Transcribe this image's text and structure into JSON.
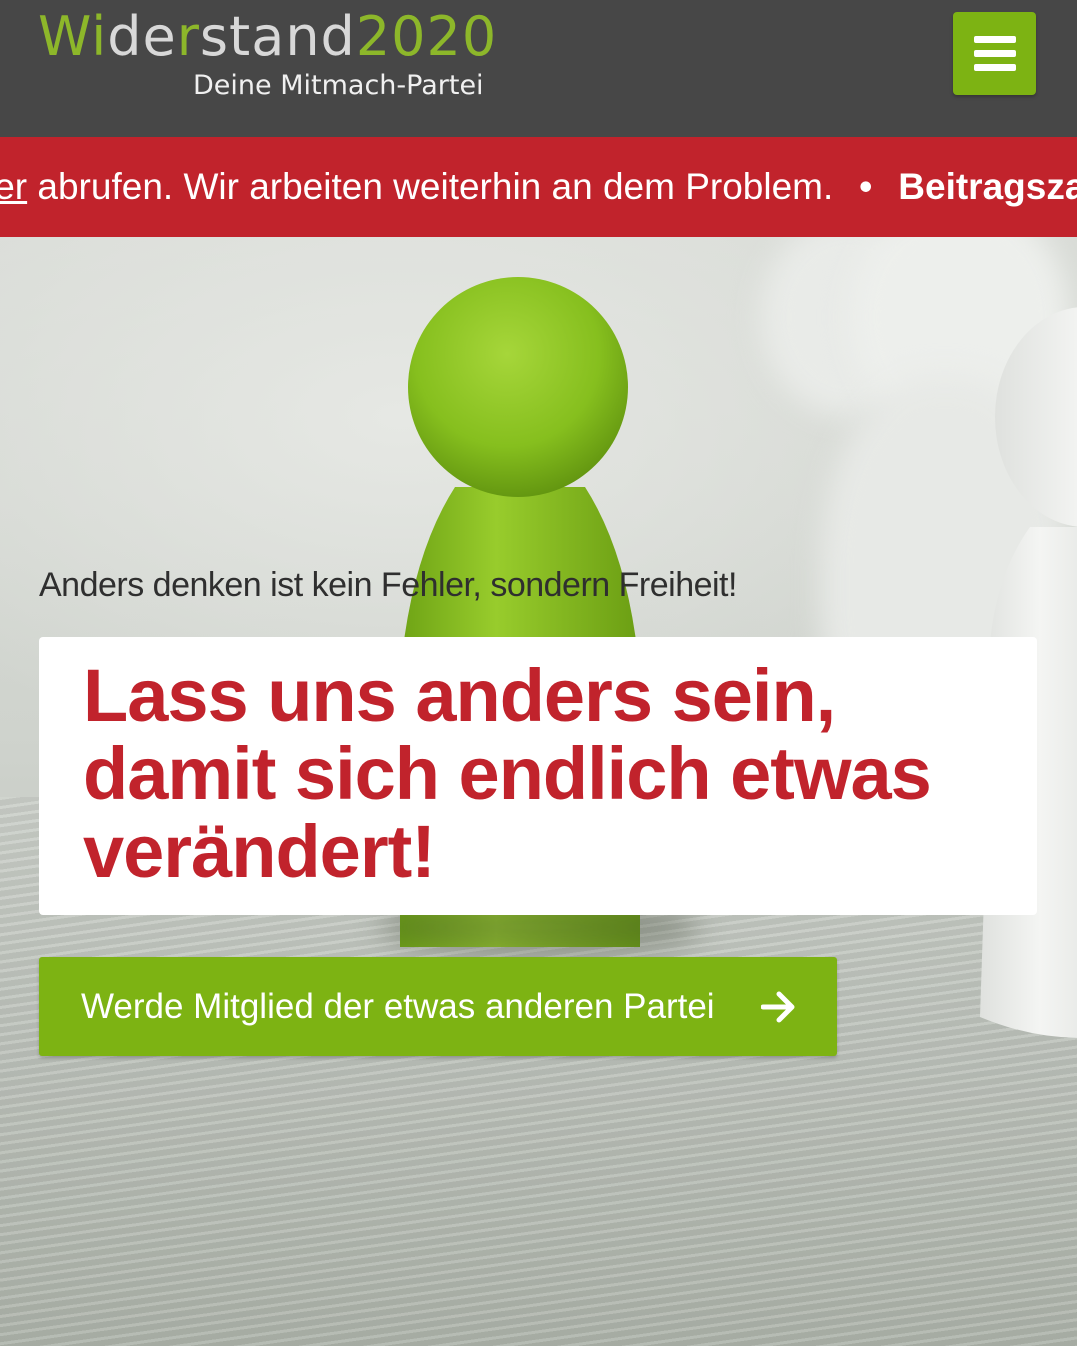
{
  "header": {
    "logo": {
      "part1": "Wi",
      "part2": "de",
      "part3": "r",
      "part4": "stand",
      "part5": "2020",
      "tagline": "Deine Mitmach-Partei"
    },
    "menu_icon": "hamburger-menu-icon"
  },
  "ticker": {
    "link_text": "ier",
    "text": " abrufen. Wir arbeiten weiterhin an dem Problem.",
    "separator": "•",
    "next_item": "Beitragszah"
  },
  "hero": {
    "subheadline": "Anders denken ist kein Fehler, sondern Freiheit!",
    "headline": "Lass uns anders sein, damit sich endlich etwas verändert!",
    "cta_label": "Werde Mitglied der etwas anderen Partei",
    "cta_icon": "arrow-right-icon"
  },
  "colors": {
    "header_bg": "#474747",
    "brand_green": "#7db313",
    "ticker_red": "#c1232c",
    "headline_red": "#c1232c"
  }
}
